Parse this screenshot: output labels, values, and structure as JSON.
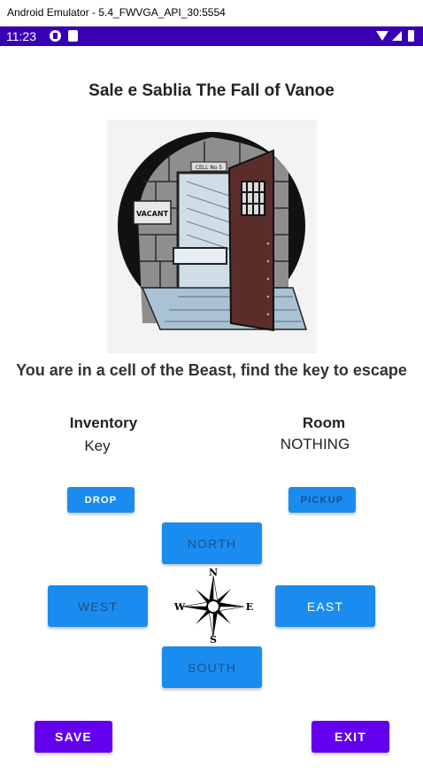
{
  "window": {
    "title": "Android Emulator - 5.4_FWVGA_API_30:5554"
  },
  "status_bar": {
    "time": "11:23",
    "bg_color": "#3700B3"
  },
  "game": {
    "title": "Sale e Sablia The Fall of Vanoe",
    "message": "You are in a cell of the Beast, find the key to escape",
    "illustration": {
      "sign_text": "VACANT",
      "plate_text": "CELL No 5"
    }
  },
  "inventory": {
    "heading": "Inventory",
    "value": "Key"
  },
  "room": {
    "heading": "Room",
    "value": "NOTHING"
  },
  "actions": {
    "drop": "DROP",
    "pickup": "PICKUP"
  },
  "directions": {
    "north": "NORTH",
    "west": "WEST",
    "east": "EAST",
    "south": "SOUTH"
  },
  "compass": {
    "n": "N",
    "s": "S",
    "e": "E",
    "w": "W"
  },
  "footer": {
    "save": "SAVE",
    "exit": "EXIT"
  },
  "colors": {
    "primary": "#6200EE",
    "status": "#3700B3",
    "button": "#1a8cf0",
    "disabled_text": "#1f4f86"
  }
}
